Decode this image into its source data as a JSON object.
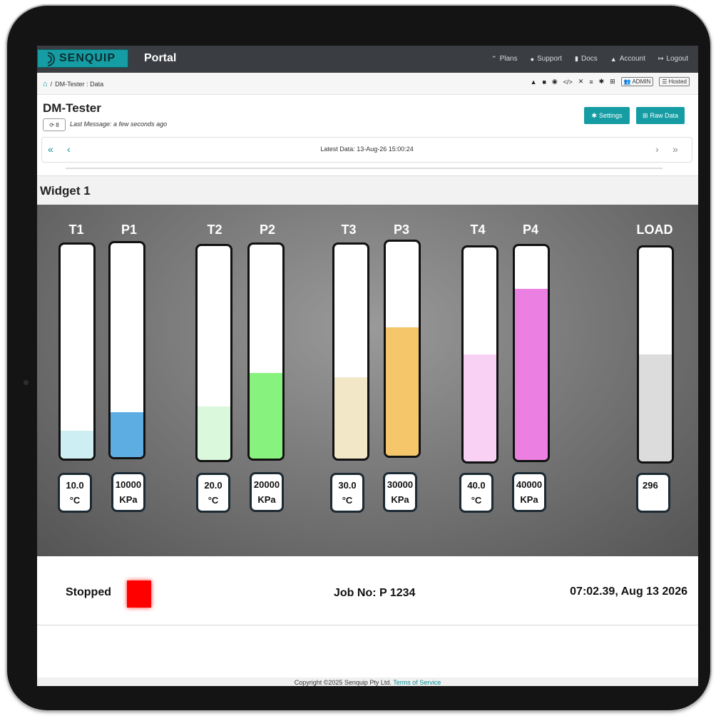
{
  "app": {
    "logo_text": "SENQUIP",
    "portal_title": "Portal"
  },
  "topnav": [
    {
      "icon": "chevrons-up-icon",
      "glyph": "⌃",
      "label": "Plans"
    },
    {
      "icon": "question-circle-icon",
      "glyph": "●",
      "label": "Support"
    },
    {
      "icon": "document-icon",
      "glyph": "▮",
      "label": "Docs"
    },
    {
      "icon": "user-icon",
      "glyph": "▲",
      "label": "Account"
    },
    {
      "icon": "logout-icon",
      "glyph": "↦",
      "label": "Logout"
    }
  ],
  "breadcrumb": {
    "home_icon": "home-icon",
    "separator": "/",
    "path": "DM-Tester : Data"
  },
  "toolbar": {
    "admin_label": "ADMIN",
    "hosted_label": "Hosted"
  },
  "device": {
    "title": "DM-Tester",
    "refresh_count": "8",
    "last_message": "Last Message: a few seconds ago"
  },
  "buttons": {
    "settings": "Settings",
    "raw_data": "Raw Data"
  },
  "data_nav": {
    "first": "«",
    "prev": "‹",
    "next": "›",
    "last": "»",
    "latest": "Latest Data: 13-Aug-26 15:00:24"
  },
  "widget": {
    "title": "Widget 1",
    "gauges": [
      {
        "label": "T1",
        "value_line1": "10.0",
        "value_line2": "°C",
        "level": 0.13,
        "color": "#cdeef2"
      },
      {
        "label": "P1",
        "value_line1": "10000",
        "value_line2": "KPa",
        "level": 0.21,
        "color": "#5dade2"
      },
      {
        "label": "T2",
        "value_line1": "20.0",
        "value_line2": "°C",
        "level": 0.25,
        "color": "#daf8dc"
      },
      {
        "label": "P2",
        "value_line1": "20000",
        "value_line2": "KPa",
        "level": 0.4,
        "color": "#88f27e"
      },
      {
        "label": "T3",
        "value_line1": "30.0",
        "value_line2": "°C",
        "level": 0.38,
        "color": "#f2e8c8"
      },
      {
        "label": "P3",
        "value_line1": "30000",
        "value_line2": "KPa",
        "level": 0.6,
        "color": "#f5c66a"
      },
      {
        "label": "T4",
        "value_line1": "40.0",
        "value_line2": "°C",
        "level": 0.5,
        "color": "#f9d1f4"
      },
      {
        "label": "P4",
        "value_line1": "40000",
        "value_line2": "KPa",
        "level": 0.8,
        "color": "#ec80e2"
      },
      {
        "label": "LOAD",
        "value_line1": "296",
        "value_line2": "",
        "level": 0.5,
        "color": "#dcdcdc"
      }
    ]
  },
  "status": {
    "state": "Stopped",
    "indicator_color": "#ff0000",
    "job": "Job No: P 1234",
    "datetime": "07:02.39, Aug 13 2026"
  },
  "footer": {
    "copyright": "Copyright ©2025 Senquip Pty Ltd.",
    "terms": "Terms of Service"
  }
}
